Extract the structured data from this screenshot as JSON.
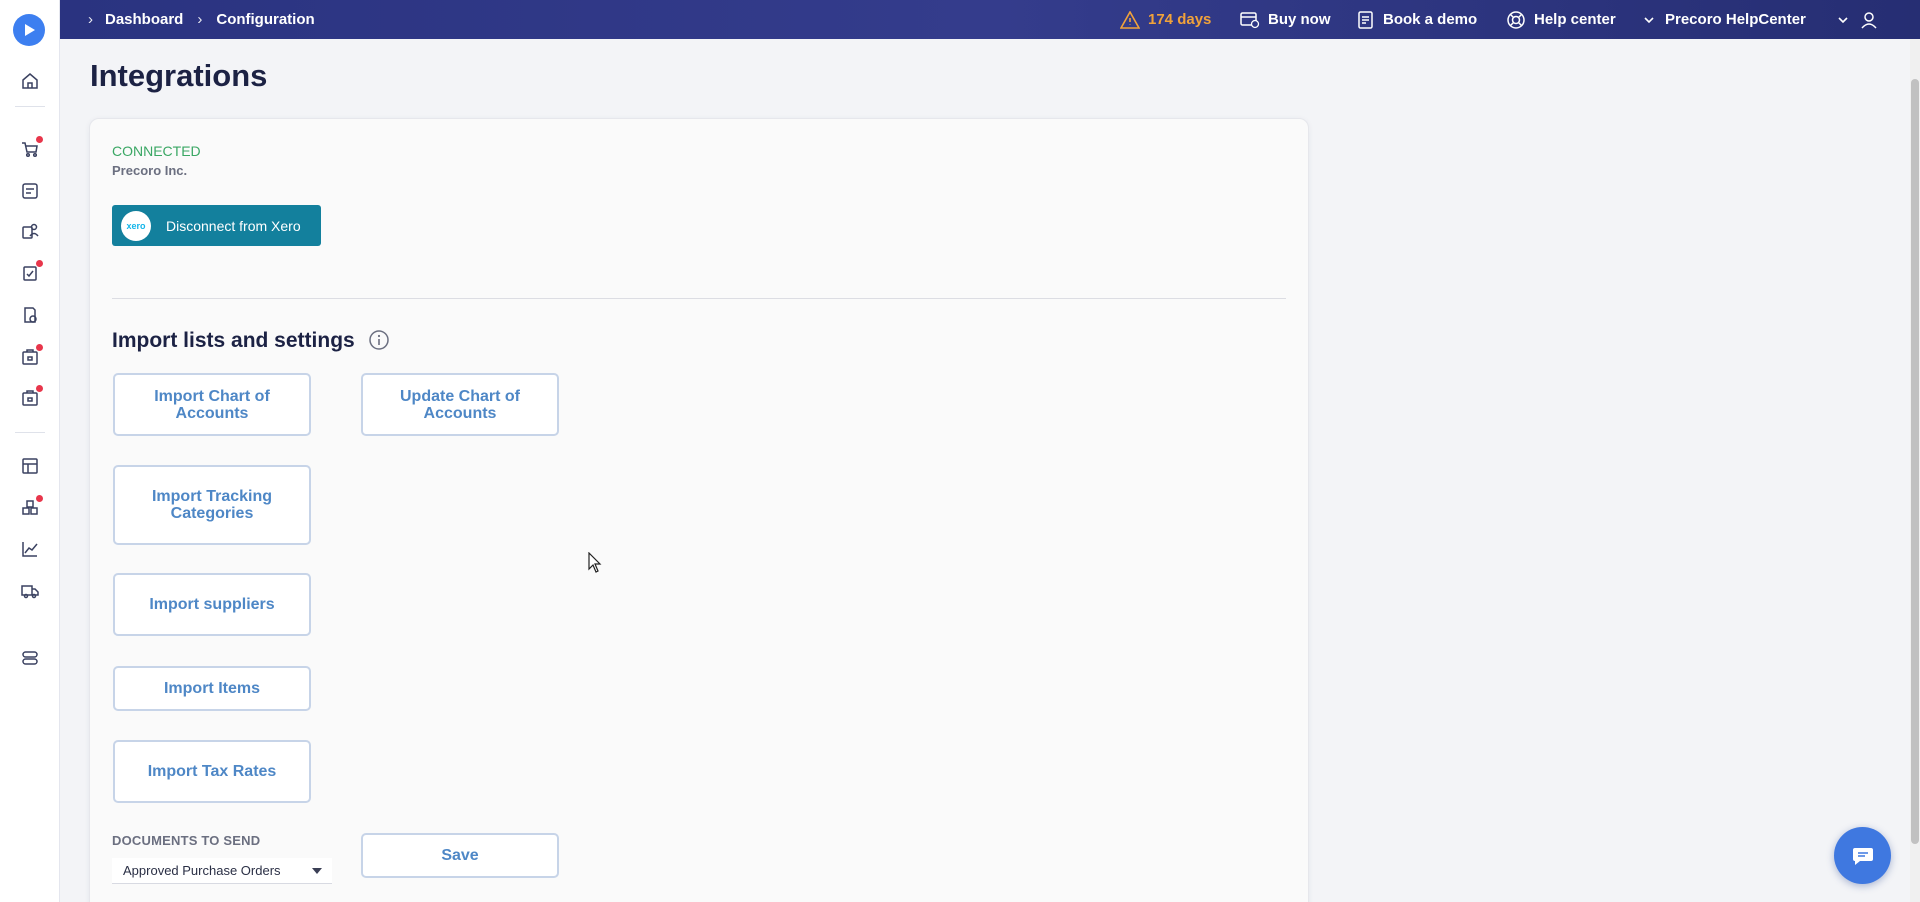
{
  "breadcrumb": {
    "items": [
      "Dashboard",
      "Configuration"
    ]
  },
  "topbar": {
    "trial_days": "174 days",
    "buy_now": "Buy now",
    "book_demo": "Book a demo",
    "help_center": "Help center",
    "account_name": "Precoro HelpCenter"
  },
  "page": {
    "title": "Integrations"
  },
  "connection": {
    "status": "CONNECTED",
    "company": "Precoro Inc.",
    "disconnect_label": "Disconnect from Xero",
    "xero_logo_text": "xero"
  },
  "import_section": {
    "title": "Import lists and settings",
    "buttons": {
      "import_coa": "Import Chart of Accounts",
      "update_coa": "Update Chart of Accounts",
      "import_tracking": "Import Tracking Categories",
      "import_suppliers": "Import suppliers",
      "import_items": "Import Items",
      "import_tax": "Import Tax Rates"
    }
  },
  "documents": {
    "label": "DOCUMENTS TO SEND",
    "selected": "Approved Purchase Orders"
  },
  "save_label": "Save",
  "colors": {
    "topbar": "#2f3786",
    "connected": "#3aa764",
    "xero_button": "#13809d",
    "action_text": "#4e87c6",
    "warning": "#f1a23a",
    "chat": "#3f78e0"
  }
}
